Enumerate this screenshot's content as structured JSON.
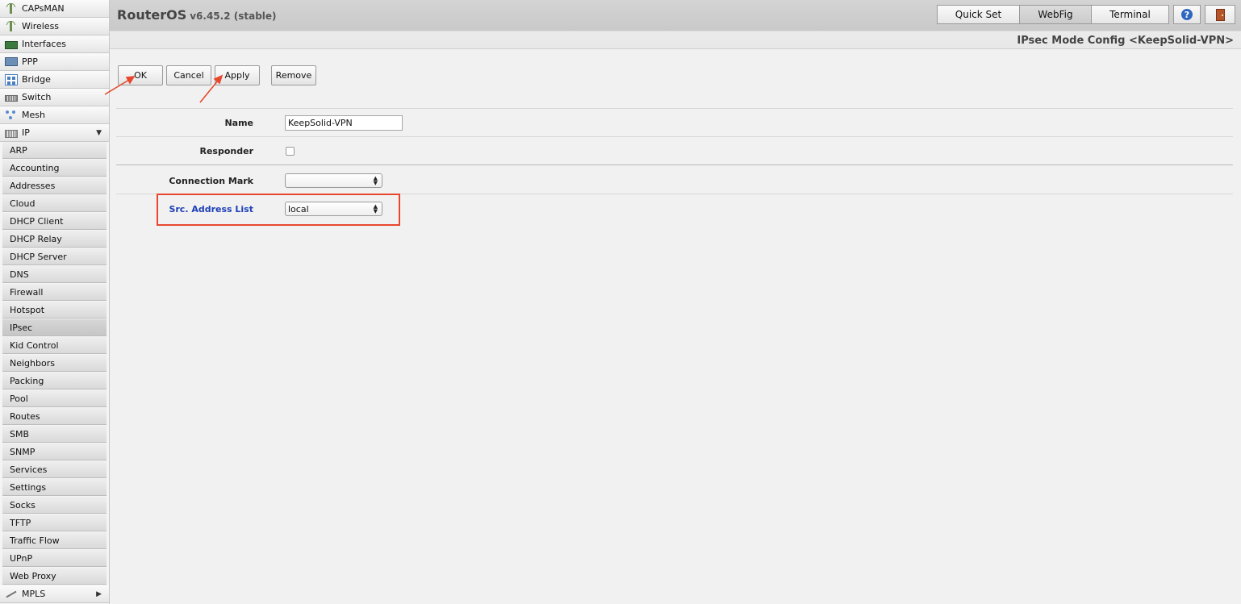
{
  "sidebar": {
    "top_items": [
      {
        "label": "CAPsMAN",
        "icon": "capsman-icon"
      },
      {
        "label": "Wireless",
        "icon": "wireless-icon"
      },
      {
        "label": "Interfaces",
        "icon": "interfaces-icon"
      },
      {
        "label": "PPP",
        "icon": "ppp-icon"
      },
      {
        "label": "Bridge",
        "icon": "bridge-icon"
      },
      {
        "label": "Switch",
        "icon": "switch-icon"
      },
      {
        "label": "Mesh",
        "icon": "mesh-icon"
      },
      {
        "label": "IP",
        "icon": "ip-icon",
        "expanded_arrow": "▼"
      }
    ],
    "ip_submenu": [
      "ARP",
      "Accounting",
      "Addresses",
      "Cloud",
      "DHCP Client",
      "DHCP Relay",
      "DHCP Server",
      "DNS",
      "Firewall",
      "Hotspot",
      "IPsec",
      "Kid Control",
      "Neighbors",
      "Packing",
      "Pool",
      "Routes",
      "SMB",
      "SNMP",
      "Services",
      "Settings",
      "Socks",
      "TFTP",
      "Traffic Flow",
      "UPnP",
      "Web Proxy"
    ],
    "active_submenu": "IPsec",
    "bottom_item": {
      "label": "MPLS",
      "icon": "mpls-icon",
      "arrow": "▶"
    }
  },
  "header": {
    "product": "RouterOS",
    "version": "v6.45.2 (stable)",
    "buttons": {
      "quick_set": "Quick Set",
      "webfig": "WebFig",
      "terminal": "Terminal"
    },
    "active_button": "WebFig",
    "help_glyph": "?",
    "page_title": "IPsec Mode Config <KeepSolid-VPN>"
  },
  "actions": {
    "ok": "OK",
    "cancel": "Cancel",
    "apply": "Apply",
    "remove": "Remove"
  },
  "form": {
    "name": {
      "label": "Name",
      "value": "KeepSolid-VPN"
    },
    "responder": {
      "label": "Responder",
      "checked": false
    },
    "connection_mark": {
      "label": "Connection Mark",
      "value": ""
    },
    "src_address_list": {
      "label": "Src. Address List",
      "value": "local"
    }
  },
  "colors": {
    "annotation": "#e8462d",
    "link_label": "#1d3fb8"
  }
}
